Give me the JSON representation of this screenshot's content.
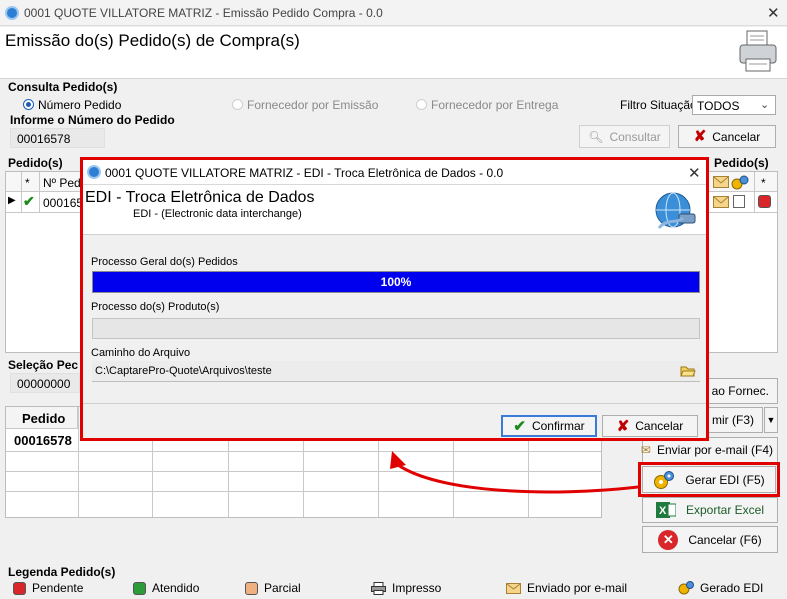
{
  "window": {
    "title": "0001 QUOTE VILLATORE MATRIZ - Emissão Pedido Compra - 0.0"
  },
  "header": {
    "title": "Emissão do(s) Pedido(s) de Compra(s)"
  },
  "consulta": {
    "group_label": "Consulta Pedido(s)",
    "radio_numero": "Número Pedido",
    "radio_fornecedor": "Fornecedor por Emissão",
    "radio_entrega": "Fornecedor por Entrega",
    "filtro_label": "Filtro Situação:",
    "filtro_value": "TODOS",
    "informe_label": "Informe o Número do Pedido",
    "numero_value": "00016578",
    "consultar_label": "Consultar",
    "cancelar_label": "Cancelar"
  },
  "pedidos": {
    "label": "Pedido(s)",
    "label_right": "Pedido(s)",
    "col_star": "*",
    "col_num": "Nº Pedi",
    "col_star2": "*",
    "row_num": "000165"
  },
  "selecao": {
    "label": "Seleção Pec",
    "value": "00000000",
    "col_pedido": "Pedido",
    "row_pedido": "00016578"
  },
  "side_buttons": {
    "enviar_fornec": "tir ao Fornec.",
    "imprimir": "mir (F3)",
    "enviar_email": "Enviar por e-mail (F4)",
    "gerar_edi": "Gerar EDI (F5)",
    "exportar_excel": "Exportar Excel",
    "cancelar_f6": "Cancelar (F6)"
  },
  "legend": {
    "title": "Legenda Pedido(s)",
    "items": [
      {
        "label": "Pendente",
        "color": "#d9262b"
      },
      {
        "label": "Atendido",
        "color": "#2e9b3a"
      },
      {
        "label": "Parcial",
        "color": "#f0b080"
      },
      {
        "label": "Impresso",
        "icon": "printer-icon"
      },
      {
        "label": "Enviado por e-mail",
        "icon": "envelope-icon"
      },
      {
        "label": "Gerado EDI",
        "icon": "gears-icon"
      }
    ]
  },
  "dialog": {
    "title": "0001 QUOTE VILLATORE MATRIZ - EDI - Troca Eletrônica de Dados - 0.0",
    "heading": "EDI - Troca Eletrônica de Dados",
    "subheading": "EDI - (Electronic data interchange)",
    "processo_geral_label": "Processo Geral do(s) Pedidos",
    "processo_geral_progress": 100,
    "processo_geral_text": "100%",
    "processo_produto_label": "Processo do(s) Produto(s)",
    "processo_produto_progress": 0,
    "caminho_label": "Caminho do Arquivo",
    "caminho_value": "C:\\CaptarePro-Quote\\Arquivos\\teste",
    "confirmar_label": "Confirmar",
    "cancelar_label": "Cancelar"
  },
  "colors": {
    "accent": "#0000ee",
    "highlight": "#e00000",
    "arrow": "#e00000"
  }
}
